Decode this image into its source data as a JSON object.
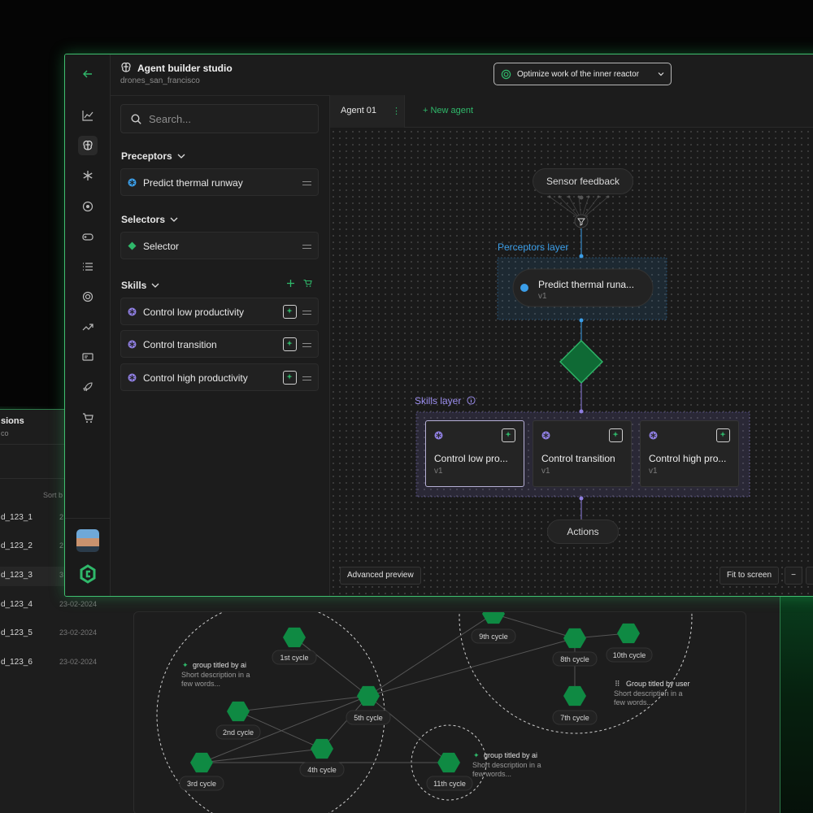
{
  "app": {
    "title": "Agent builder studio",
    "subtitle": "drones_san_francisco",
    "goal_selector": "Optimize work of the inner reactor"
  },
  "colors": {
    "accent": "#2fb86a",
    "perceptor": "#3b9ee8",
    "skill": "#8e7ee0",
    "window_border": "#3fbf6f"
  },
  "rail": {
    "icons": [
      "back-arrow-icon",
      "chart-icon",
      "brain-icon",
      "snowflake-icon",
      "aperture-icon",
      "gamepad-icon",
      "list-icon",
      "target-icon",
      "trend-up-icon",
      "id-card-icon",
      "rocket-icon",
      "cart-icon"
    ]
  },
  "search": {
    "placeholder": "Search..."
  },
  "left_panel": {
    "preceptors_title": "Preceptors",
    "preceptors": [
      {
        "label": "Predict thermal runway"
      }
    ],
    "selectors_title": "Selectors",
    "selectors": [
      {
        "label": "Selector"
      }
    ],
    "skills_title": "Skills",
    "skills": [
      {
        "label": "Control low productivity"
      },
      {
        "label": "Control transition"
      },
      {
        "label": "Control high productivity"
      }
    ]
  },
  "tabs": {
    "agent_tab": "Agent 01",
    "tab_menu": "⋮",
    "new_agent": "+  New agent"
  },
  "flow": {
    "sensor": "Sensor feedback",
    "perceptors_layer": "Perceptors layer",
    "perceptor_node": {
      "label": "Predict thermal runa...",
      "version": "v1"
    },
    "skills_layer": "Skills layer",
    "skill_nodes": [
      {
        "label": "Control low pro...",
        "version": "v1"
      },
      {
        "label": "Control transition",
        "version": "v1"
      },
      {
        "label": "Control high pro...",
        "version": "v1"
      }
    ],
    "actions": "Actions"
  },
  "bottom_bar": {
    "advanced_preview": "Advanced preview",
    "fit_to_screen": "Fit to screen",
    "zoom_out": "−"
  },
  "back_window": {
    "title": "sions",
    "subtitle": "co",
    "sort_label": "Sort b",
    "rows": [
      {
        "id": "d_123_1",
        "date": "2"
      },
      {
        "id": "d_123_2",
        "date": "2"
      },
      {
        "id": "d_123_3",
        "date": "3"
      },
      {
        "id": "d_123_4",
        "date": "23-02-2024"
      },
      {
        "id": "d_123_5",
        "date": "23-02-2024"
      },
      {
        "id": "d_123_6",
        "date": "23-02-2024"
      }
    ]
  },
  "cycle_graph": {
    "nodes": [
      "1st cycle",
      "2nd cycle",
      "3rd cycle",
      "4th cycle",
      "5th cycle",
      "7th cycle",
      "8th cycle",
      "9th cycle",
      "10th cycle",
      "11th cycle"
    ],
    "groups": [
      {
        "title": "group titled by ai",
        "desc_1": "Short description in a",
        "desc_2": "few words..."
      },
      {
        "title": "Group titled by user",
        "desc_1": "Short description in a",
        "desc_2": "few words..."
      },
      {
        "title": "group titled by ai",
        "desc_1": "Short description in a",
        "desc_2": "few words..."
      }
    ]
  }
}
